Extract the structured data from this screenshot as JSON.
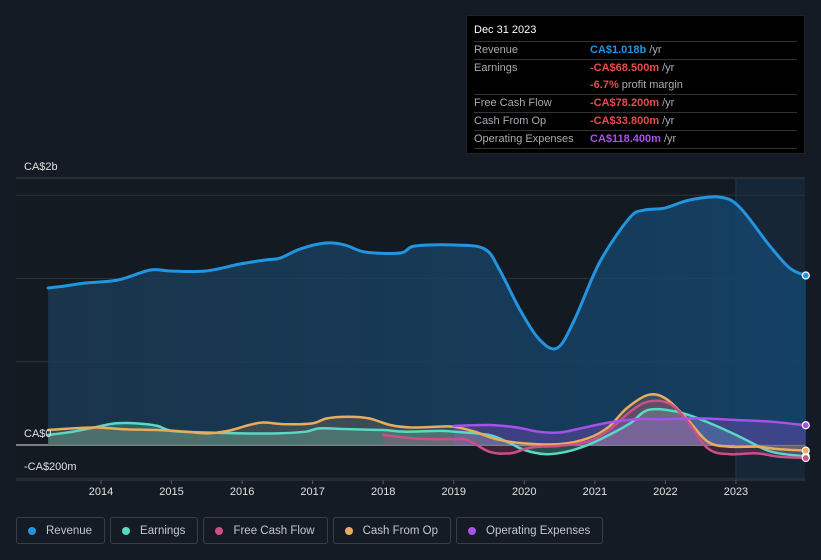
{
  "tooltip": {
    "date": "Dec 31 2023",
    "rows": [
      {
        "label": "Revenue",
        "value": "CA$1.018b",
        "unit": "/yr",
        "color": "#2394df"
      },
      {
        "label": "Earnings",
        "value": "-CA$68.500m",
        "unit": "/yr",
        "color": "#e64c4c"
      },
      {
        "label": "",
        "value": "-6.7%",
        "unit": "profit margin",
        "color": "#e64c4c"
      },
      {
        "label": "Free Cash Flow",
        "value": "-CA$78.200m",
        "unit": "/yr",
        "color": "#e64c4c"
      },
      {
        "label": "Cash From Op",
        "value": "-CA$33.800m",
        "unit": "/yr",
        "color": "#e64c4c"
      },
      {
        "label": "Operating Expenses",
        "value": "CA$118.400m",
        "unit": "/yr",
        "color": "#a651e8"
      }
    ]
  },
  "chart_data": {
    "type": "area",
    "title": "",
    "xlabel": "",
    "ylabel": "",
    "x_unit": "year",
    "y_unit": "CA$ millions",
    "xlim": [
      2013.25,
      2024.0
    ],
    "ylim": [
      -200,
      1600
    ],
    "y_tick_labels": [
      {
        "value": 2000,
        "label": "CA$2b"
      },
      {
        "value": 0,
        "label": "CA$0"
      },
      {
        "value": -200,
        "label": "-CA$200m"
      }
    ],
    "y_gridlines": [
      1500,
      1000,
      500,
      0,
      -200
    ],
    "x_ticks": [
      2014,
      2015,
      2016,
      2017,
      2018,
      2019,
      2020,
      2021,
      2022,
      2023
    ],
    "forecast_shade_start": 2023.0,
    "grid": true,
    "legend_position": "bottom-left",
    "series": [
      {
        "name": "Revenue",
        "color": "#2394df",
        "points": [
          [
            2013.25,
            943
          ],
          [
            2013.49,
            955
          ],
          [
            2013.78,
            973
          ],
          [
            2014.24,
            991
          ],
          [
            2014.7,
            1051
          ],
          [
            2014.98,
            1045
          ],
          [
            2015.48,
            1045
          ],
          [
            2015.97,
            1087
          ],
          [
            2016.33,
            1111
          ],
          [
            2016.54,
            1123
          ],
          [
            2016.82,
            1177
          ],
          [
            2017.18,
            1213
          ],
          [
            2017.46,
            1201
          ],
          [
            2017.74,
            1159
          ],
          [
            2018.24,
            1153
          ],
          [
            2018.45,
            1195
          ],
          [
            2019.02,
            1201
          ],
          [
            2019.44,
            1177
          ],
          [
            2019.65,
            1051
          ],
          [
            2019.94,
            811
          ],
          [
            2020.22,
            631
          ],
          [
            2020.47,
            583
          ],
          [
            2020.71,
            751
          ],
          [
            2021.07,
            1099
          ],
          [
            2021.49,
            1363
          ],
          [
            2021.7,
            1411
          ],
          [
            2021.99,
            1423
          ],
          [
            2022.34,
            1471
          ],
          [
            2022.77,
            1489
          ],
          [
            2023.05,
            1429
          ],
          [
            2023.47,
            1201
          ],
          [
            2023.76,
            1063
          ],
          [
            2023.99,
            1018
          ]
        ]
      },
      {
        "name": "Earnings",
        "color": "#58d9c4",
        "points": [
          [
            2013.25,
            60
          ],
          [
            2013.6,
            80
          ],
          [
            2013.9,
            105
          ],
          [
            2014.2,
            130
          ],
          [
            2014.5,
            130
          ],
          [
            2014.8,
            115
          ],
          [
            2015.0,
            85
          ],
          [
            2015.5,
            75
          ],
          [
            2016.0,
            70
          ],
          [
            2016.5,
            70
          ],
          [
            2016.9,
            80
          ],
          [
            2017.1,
            100
          ],
          [
            2017.5,
            95
          ],
          [
            2018.0,
            90
          ],
          [
            2018.3,
            80
          ],
          [
            2018.8,
            85
          ],
          [
            2019.0,
            80
          ],
          [
            2019.5,
            60
          ],
          [
            2019.8,
            10
          ],
          [
            2020.0,
            -30
          ],
          [
            2020.3,
            -55
          ],
          [
            2020.6,
            -40
          ],
          [
            2020.9,
            0
          ],
          [
            2021.2,
            60
          ],
          [
            2021.5,
            130
          ],
          [
            2021.75,
            210
          ],
          [
            2022.1,
            205
          ],
          [
            2022.4,
            170
          ],
          [
            2022.8,
            100
          ],
          [
            2023.1,
            40
          ],
          [
            2023.5,
            -40
          ],
          [
            2023.99,
            -68.5
          ]
        ]
      },
      {
        "name": "Free Cash Flow",
        "color": "#cb4f88",
        "points": [
          [
            2018.0,
            60
          ],
          [
            2018.3,
            45
          ],
          [
            2018.6,
            35
          ],
          [
            2019.0,
            35
          ],
          [
            2019.2,
            30
          ],
          [
            2019.5,
            -40
          ],
          [
            2019.8,
            -50
          ],
          [
            2020.1,
            -15
          ],
          [
            2020.5,
            -5
          ],
          [
            2020.9,
            20
          ],
          [
            2021.2,
            90
          ],
          [
            2021.5,
            200
          ],
          [
            2021.75,
            260
          ],
          [
            2022.05,
            250
          ],
          [
            2022.3,
            150
          ],
          [
            2022.6,
            -20
          ],
          [
            2022.9,
            -55
          ],
          [
            2023.3,
            -50
          ],
          [
            2023.6,
            -70
          ],
          [
            2023.99,
            -78.2
          ]
        ]
      },
      {
        "name": "Cash From Op",
        "color": "#e9ac5e",
        "points": [
          [
            2013.25,
            90
          ],
          [
            2013.6,
            100
          ],
          [
            2013.95,
            105
          ],
          [
            2014.3,
            95
          ],
          [
            2014.8,
            90
          ],
          [
            2015.2,
            80
          ],
          [
            2015.5,
            70
          ],
          [
            2015.8,
            85
          ],
          [
            2016.1,
            120
          ],
          [
            2016.3,
            135
          ],
          [
            2016.6,
            125
          ],
          [
            2017.0,
            130
          ],
          [
            2017.2,
            160
          ],
          [
            2017.5,
            170
          ],
          [
            2017.8,
            160
          ],
          [
            2018.1,
            120
          ],
          [
            2018.4,
            105
          ],
          [
            2018.8,
            110
          ],
          [
            2019.0,
            110
          ],
          [
            2019.3,
            80
          ],
          [
            2019.6,
            35
          ],
          [
            2020.0,
            10
          ],
          [
            2020.5,
            5
          ],
          [
            2020.9,
            40
          ],
          [
            2021.2,
            110
          ],
          [
            2021.45,
            220
          ],
          [
            2021.75,
            300
          ],
          [
            2022.0,
            280
          ],
          [
            2022.3,
            160
          ],
          [
            2022.6,
            20
          ],
          [
            2022.9,
            -10
          ],
          [
            2023.3,
            -10
          ],
          [
            2023.6,
            -25
          ],
          [
            2023.99,
            -33.8
          ]
        ]
      },
      {
        "name": "Operating Expenses",
        "color": "#a651e8",
        "points": [
          [
            2019.0,
            115
          ],
          [
            2019.5,
            120
          ],
          [
            2019.9,
            105
          ],
          [
            2020.2,
            80
          ],
          [
            2020.5,
            75
          ],
          [
            2020.8,
            100
          ],
          [
            2021.2,
            135
          ],
          [
            2021.6,
            155
          ],
          [
            2022.0,
            155
          ],
          [
            2022.5,
            160
          ],
          [
            2023.0,
            150
          ],
          [
            2023.5,
            140
          ],
          [
            2023.99,
            118.4
          ]
        ]
      }
    ]
  },
  "legend": [
    {
      "label": "Revenue",
      "color": "#2394df"
    },
    {
      "label": "Earnings",
      "color": "#58d9c4"
    },
    {
      "label": "Free Cash Flow",
      "color": "#cb4f88"
    },
    {
      "label": "Cash From Op",
      "color": "#e9ac5e"
    },
    {
      "label": "Operating Expenses",
      "color": "#a651e8"
    }
  ]
}
